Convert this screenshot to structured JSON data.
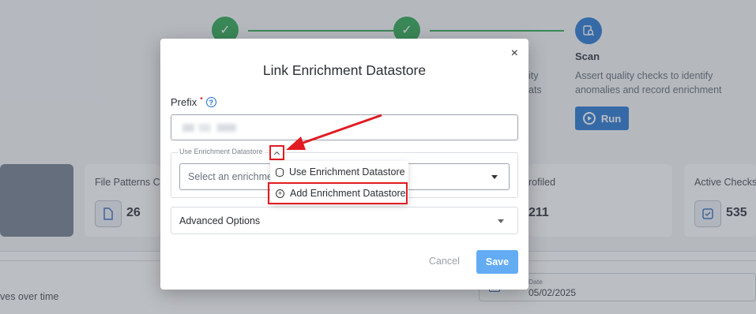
{
  "background": {
    "steps": {
      "scan_title": "Scan",
      "scan_description": "Assert quality checks to identify anomalies and record enrichment",
      "partial_text_1": "ity",
      "partial_text_2": "ats",
      "run_label": "Run"
    },
    "stats": [
      {
        "label": "File Patterns Ca",
        "value": "26",
        "icon": "file-icon"
      },
      {
        "label": "rofiled",
        "value": "211"
      },
      {
        "label": "Active Checks",
        "value": "535",
        "icon": "checkbox-icon"
      }
    ],
    "lower": {
      "over_time_label": "ves over time",
      "date_label": "Date",
      "date_value": "05/02/2025"
    }
  },
  "modal": {
    "title": "Link Enrichment Datastore",
    "close_icon": "×",
    "prefix_label": "Prefix",
    "required_mark": "•",
    "help_icon": "?",
    "fieldset_legend": "Use Enrichment Datastore",
    "select_placeholder": "Select an enrichme",
    "advanced_label": "Advanced Options",
    "cancel_label": "Cancel",
    "save_label": "Save"
  },
  "menu": {
    "items": [
      {
        "label": "Use Enrichment Datastore",
        "icon": "database-icon"
      },
      {
        "label": "Add Enrichment Datastore",
        "icon": "plus-circle-icon"
      }
    ]
  },
  "colors": {
    "primary": "#1b6fd1",
    "success": "#22a047",
    "highlight": "#e21b22",
    "save_button": "#63acf3"
  }
}
